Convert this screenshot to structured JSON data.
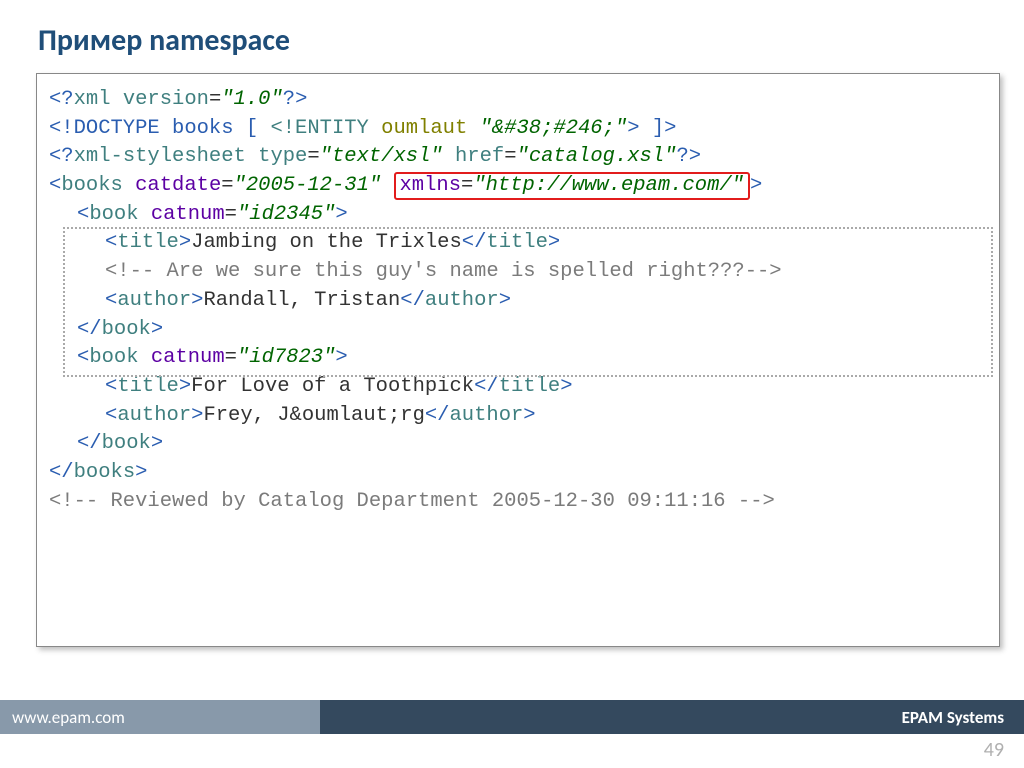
{
  "title": "Пример namespace",
  "code": {
    "l1a": "<?",
    "l1b": "xml version",
    "l1c": "=",
    "l1d": "\"1.0\"",
    "l1e": "?>",
    "l2a": "<!DOCTYPE books [ ",
    "l2b": "<!ENTITY",
    "l2c": " oumlaut ",
    "l2d": "\"&#38;#246;\"",
    "l2e": ">",
    "l2f": " ]>",
    "l3a": "<?",
    "l3b": "xml-stylesheet type",
    "l3c": "=",
    "l3d": "\"text/xsl\"",
    "l3e": " href",
    "l3f": "=",
    "l3g": "\"catalog.xsl\"",
    "l3h": "?>",
    "l4a": "<",
    "l4b": "books",
    "l4c": " catdate",
    "l4d": "=",
    "l4e": "\"2005-12-31\"",
    "l4f": " ",
    "l4box_a": "xmlns",
    "l4box_b": "=",
    "l4box_c": "\"http://www.epam.com/\"",
    "l4g": ">",
    "l5a": "<",
    "l5b": "book",
    "l5c": " catnum",
    "l5d": "=",
    "l5e": "\"id2345\"",
    "l5f": ">",
    "l6a": "<",
    "l6b": "title",
    "l6c": ">",
    "l6d": "Jambing on the Trixles",
    "l6e": "</",
    "l6f": "title",
    "l6g": ">",
    "l7": "<!-- Are we sure this guy's name is spelled right???-->",
    "l8a": "<",
    "l8b": "author",
    "l8c": ">",
    "l8d": "Randall, Tristan",
    "l8e": "</",
    "l8f": "author",
    "l8g": ">",
    "l9a": "</",
    "l9b": "book",
    "l9c": ">",
    "l10a": "<",
    "l10b": "book",
    "l10c": " catnum",
    "l10d": "=",
    "l10e": "\"id7823\"",
    "l10f": ">",
    "l11a": "<",
    "l11b": "title",
    "l11c": ">",
    "l11d": "For Love of a Toothpick",
    "l11e": "</",
    "l11f": "title",
    "l11g": ">",
    "l12a": "<",
    "l12b": "author",
    "l12c": ">",
    "l12d": "Frey, J&oumlaut;rg",
    "l12e": "</",
    "l12f": "author",
    "l12g": ">",
    "l13a": "</",
    "l13b": "book",
    "l13c": ">",
    "l14a": "</",
    "l14b": "books",
    "l14c": ">",
    "l15": "<!-- Reviewed by Catalog Department 2005-12-30 09:11:16 -->"
  },
  "footer": {
    "left": "www.epam.com",
    "right": "EPAM Systems"
  },
  "page_number": "49"
}
